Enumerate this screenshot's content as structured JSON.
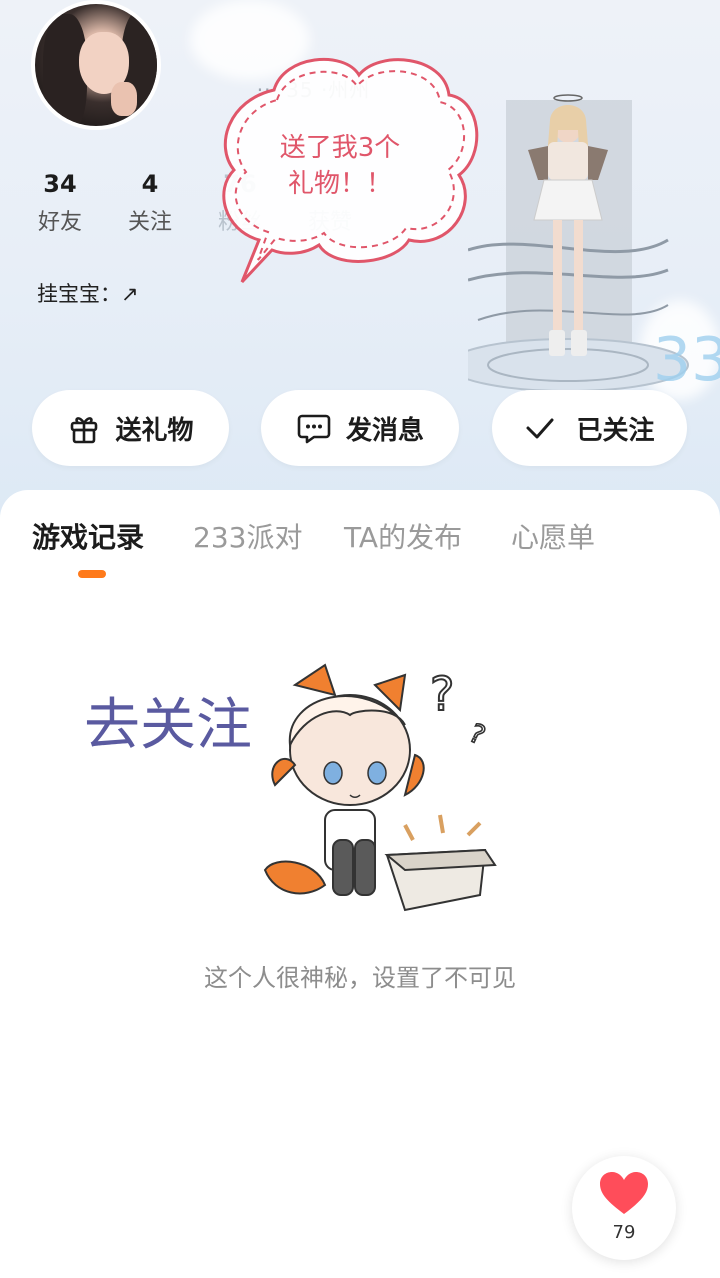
{
  "profile": {
    "name_partial": "　 　 ··· 35 ·州州",
    "stats": [
      {
        "value": "34",
        "label": "好友"
      },
      {
        "value": "4",
        "label": "关注"
      },
      {
        "value": "76",
        "label": "粉丝"
      },
      {
        "value": "8",
        "label": "获赞"
      }
    ],
    "pendant_label": "挂宝宝：↗"
  },
  "bubble": {
    "text_line1": "送了我3个",
    "text_line2": "礼物！！"
  },
  "actions": {
    "gift_label": "送礼物",
    "message_label": "发消息",
    "follow_label": "已关注"
  },
  "tabs": [
    {
      "label": "游戏记录"
    },
    {
      "label": "233派对"
    },
    {
      "label": "TA的发布"
    },
    {
      "label": "心愿单"
    }
  ],
  "empty_state": {
    "overlay_text": "去关注",
    "message": "这个人很神秘，设置了不可见"
  },
  "like": {
    "count": "79"
  },
  "colors": {
    "accent": "#ff7a1a",
    "bubble": "#e0566a",
    "overlay_text": "#5a5aa0",
    "heart": "#ff4d5a"
  }
}
